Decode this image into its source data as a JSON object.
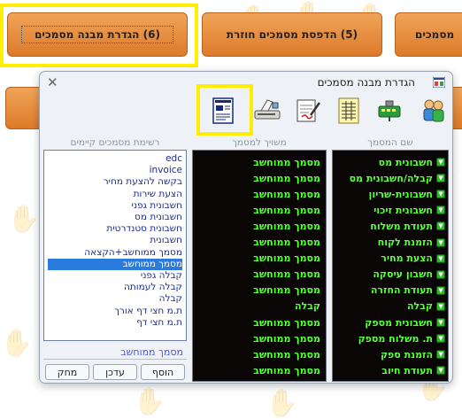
{
  "top_buttons": [
    {
      "label": "(6)  הגדרת מבנה מסמכים"
    },
    {
      "label": "(5)  הדפסת מסמכים חוזרת"
    },
    {
      "label": "מסמכים"
    }
  ],
  "dialog": {
    "title": "הגדרת מבנה מסמכים",
    "close": "✕",
    "toolbar_icons": [
      "users-icon",
      "network-icon",
      "spreadsheet-icon",
      "edit-document-icon",
      "scanner-icon",
      "form-layout-icon"
    ],
    "doc_name_panel": {
      "title": "שם המסמך",
      "items": [
        "חשבונית מס",
        "קבלה/חשבונית מס",
        "חשבונית-שריון",
        "חשבונית זיכוי",
        "תעודת משלוח",
        "הזמנת לקוח",
        "הצעת מחיר",
        "חשבון עיסקה",
        "תעודת החזרה",
        "קבלה",
        "חשבונית מספק",
        "ת. משלוח מספק",
        "הזמנת ספק",
        "תעודת חיוב"
      ]
    },
    "assignment_panel": {
      "title": "משויך למסמך",
      "items": [
        "מסמך ממוחשב",
        "מסמך ממוחשב",
        "מסמך ממוחשב",
        "מסמך ממוחשב",
        "מסמך ממוחשב",
        "מסמך ממוחשב",
        "מסמך ממוחשב",
        "מסמך ממוחשב",
        "מסמך ממוחשב",
        "קבלה",
        "מסמך ממוחשב",
        "מסמך ממוחשב",
        "מסמך ממוחשב",
        "מסמך ממוחשב"
      ]
    },
    "existing_panel": {
      "title": "רשימת מסמכים קיימים",
      "items": [
        "edc",
        "invoice",
        "בקשה להצעת מחיר",
        "הצעת שירות",
        "חשבונית גפני",
        "חשבונית מס",
        "חשבונית סטנדרטית",
        "חשבונית",
        "מסמך ממוחשב+הקצאה",
        "מסמך ממוחשב",
        "קבלה גפני",
        "קבלה לעמותה",
        "קבלה",
        "ת.מ חצי דף אורך",
        "ת.מ חצי דף"
      ],
      "selected_index": 9,
      "name_field": "מסמך ממוחשב",
      "buttons": {
        "add": "הוסף",
        "update": "עדכן",
        "delete": "מחק"
      }
    }
  }
}
